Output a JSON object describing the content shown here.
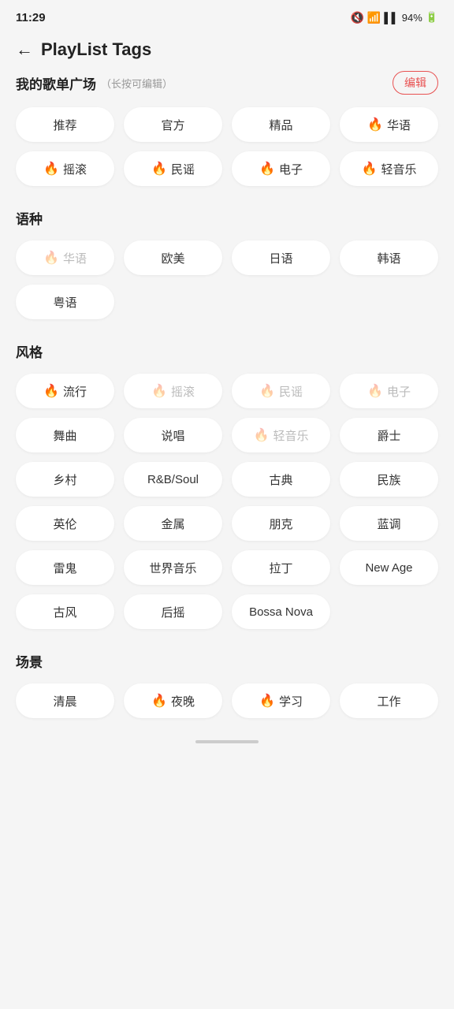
{
  "statusBar": {
    "time": "11:29",
    "battery": "94%"
  },
  "header": {
    "backLabel": "←",
    "title": "PlayList Tags"
  },
  "myPlaylist": {
    "title": "我的歌单广场",
    "subtitle": "（长按可编辑）",
    "editLabel": "编辑",
    "tags": [
      {
        "label": "推荐",
        "hot": false,
        "disabled": false
      },
      {
        "label": "官方",
        "hot": false,
        "disabled": false
      },
      {
        "label": "精品",
        "hot": false,
        "disabled": false
      },
      {
        "label": "华语",
        "hot": true,
        "disabled": false
      },
      {
        "label": "摇滚",
        "hot": true,
        "disabled": false
      },
      {
        "label": "民谣",
        "hot": true,
        "disabled": false
      },
      {
        "label": "电子",
        "hot": true,
        "disabled": false
      },
      {
        "label": "轻音乐",
        "hot": true,
        "disabled": false
      }
    ]
  },
  "language": {
    "title": "语种",
    "tags": [
      {
        "label": "华语",
        "hot": true,
        "disabled": true
      },
      {
        "label": "欧美",
        "hot": false,
        "disabled": false
      },
      {
        "label": "日语",
        "hot": false,
        "disabled": false
      },
      {
        "label": "韩语",
        "hot": false,
        "disabled": false
      },
      {
        "label": "粤语",
        "hot": false,
        "disabled": false
      }
    ]
  },
  "style": {
    "title": "风格",
    "tags": [
      {
        "label": "流行",
        "hot": true,
        "disabled": false
      },
      {
        "label": "摇滚",
        "hot": true,
        "disabled": true
      },
      {
        "label": "民谣",
        "hot": true,
        "disabled": true
      },
      {
        "label": "电子",
        "hot": true,
        "disabled": true
      },
      {
        "label": "舞曲",
        "hot": false,
        "disabled": false
      },
      {
        "label": "说唱",
        "hot": false,
        "disabled": false
      },
      {
        "label": "轻音乐",
        "hot": true,
        "disabled": true
      },
      {
        "label": "爵士",
        "hot": false,
        "disabled": false
      },
      {
        "label": "乡村",
        "hot": false,
        "disabled": false
      },
      {
        "label": "R&B/Soul",
        "hot": false,
        "disabled": false
      },
      {
        "label": "古典",
        "hot": false,
        "disabled": false
      },
      {
        "label": "民族",
        "hot": false,
        "disabled": false
      },
      {
        "label": "英伦",
        "hot": false,
        "disabled": false
      },
      {
        "label": "金属",
        "hot": false,
        "disabled": false
      },
      {
        "label": "朋克",
        "hot": false,
        "disabled": false
      },
      {
        "label": "蓝调",
        "hot": false,
        "disabled": false
      },
      {
        "label": "雷鬼",
        "hot": false,
        "disabled": false
      },
      {
        "label": "世界音乐",
        "hot": false,
        "disabled": false
      },
      {
        "label": "拉丁",
        "hot": false,
        "disabled": false
      },
      {
        "label": "New Age",
        "hot": false,
        "disabled": false
      },
      {
        "label": "古风",
        "hot": false,
        "disabled": false
      },
      {
        "label": "后摇",
        "hot": false,
        "disabled": false
      },
      {
        "label": "Bossa Nova",
        "hot": false,
        "disabled": false
      }
    ]
  },
  "scene": {
    "title": "场景",
    "tags": [
      {
        "label": "清晨",
        "hot": false,
        "disabled": false
      },
      {
        "label": "夜晚",
        "hot": true,
        "disabled": false
      },
      {
        "label": "学习",
        "hot": true,
        "disabled": false
      },
      {
        "label": "工作",
        "hot": false,
        "disabled": false
      }
    ]
  }
}
